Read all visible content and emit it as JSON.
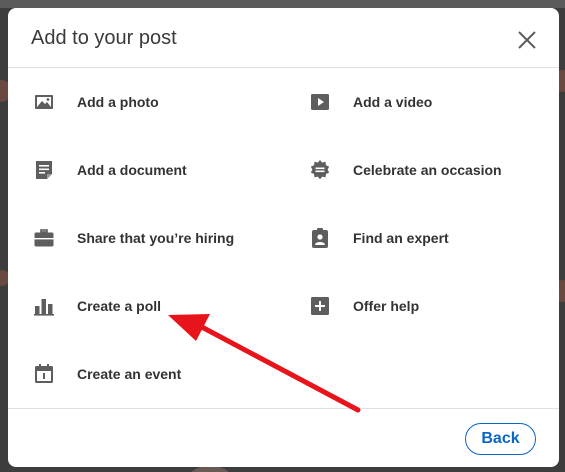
{
  "modal": {
    "title": "Add to your post",
    "close_icon": "close-icon"
  },
  "options": [
    {
      "label": "Add a photo",
      "icon": "photo-icon"
    },
    {
      "label": "Add a video",
      "icon": "video-icon"
    },
    {
      "label": "Add a document",
      "icon": "document-icon"
    },
    {
      "label": "Celebrate an occasion",
      "icon": "celebrate-icon"
    },
    {
      "label": "Share that you’re hiring",
      "icon": "briefcase-icon"
    },
    {
      "label": "Find an expert",
      "icon": "expert-badge-icon"
    },
    {
      "label": "Create a poll",
      "icon": "poll-icon"
    },
    {
      "label": "Offer help",
      "icon": "plus-box-icon"
    },
    {
      "label": "Create an event",
      "icon": "calendar-icon"
    }
  ],
  "footer": {
    "back_label": "Back"
  },
  "colors": {
    "icon": "#5e5e5e",
    "accent": "#0a66c2",
    "annotation_arrow": "#e8141c"
  }
}
